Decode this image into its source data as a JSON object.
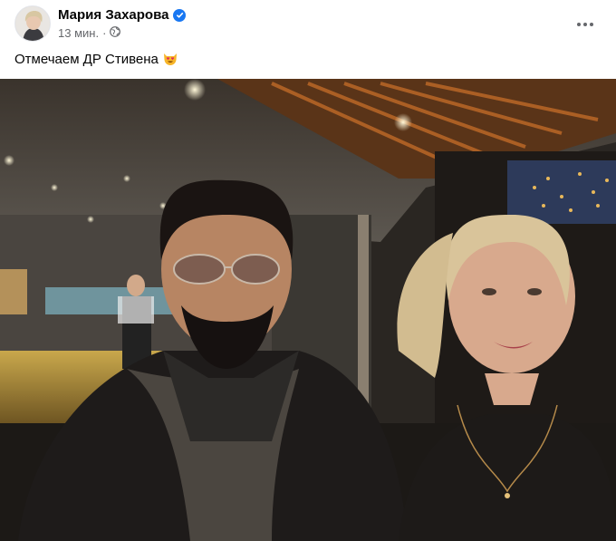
{
  "post": {
    "author": "Мария Захарова",
    "time": "13 мин.",
    "caption": "Отмечаем ДР Стивена",
    "emoji_icon": "smiling-cat-heart-eyes-icon",
    "verified_color": "#1877f2"
  }
}
